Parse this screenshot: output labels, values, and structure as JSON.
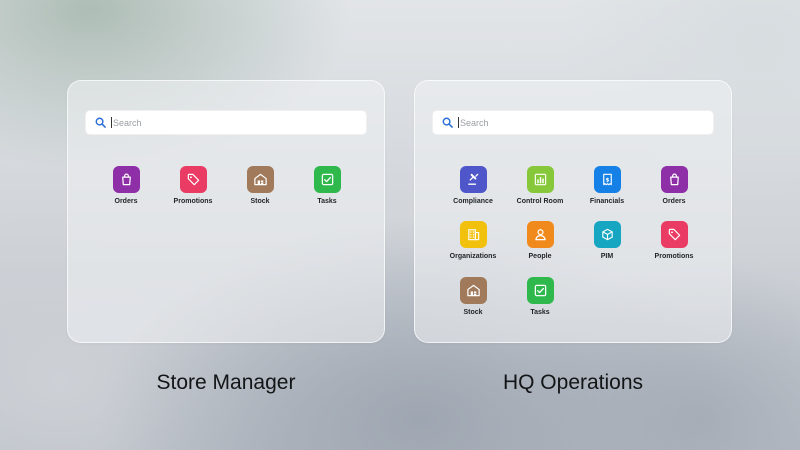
{
  "colors": {
    "orders": "#8e2fa7",
    "promotions": "#ea3b64",
    "stock": "#a07a5a",
    "tasks": "#2fb84c",
    "compliance": "#4f56c9",
    "control_room": "#86c83a",
    "financials": "#1581e6",
    "organizations": "#f2c10e",
    "people": "#f18a1d",
    "pim": "#16a6c1",
    "search_icon": "#2d6fd6"
  },
  "store_manager": {
    "title": "Store Manager",
    "search": {
      "placeholder": "Search",
      "icon": "search-icon"
    },
    "apps": [
      {
        "label": "Orders",
        "icon": "shopping-bag-icon"
      },
      {
        "label": "Promotions",
        "icon": "tag-icon"
      },
      {
        "label": "Stock",
        "icon": "warehouse-icon"
      },
      {
        "label": "Tasks",
        "icon": "checkbox-icon"
      }
    ]
  },
  "hq_operations": {
    "title": "HQ Operations",
    "search": {
      "placeholder": "Search",
      "icon": "search-icon"
    },
    "apps": [
      {
        "label": "Compliance",
        "icon": "gavel-icon"
      },
      {
        "label": "Control Room",
        "icon": "bar-chart-icon"
      },
      {
        "label": "Financials",
        "icon": "receipt-icon"
      },
      {
        "label": "Orders",
        "icon": "shopping-bag-icon"
      },
      {
        "label": "Organizations",
        "icon": "building-icon"
      },
      {
        "label": "People",
        "icon": "person-icon"
      },
      {
        "label": "PIM",
        "icon": "cube-icon"
      },
      {
        "label": "Promotions",
        "icon": "tag-icon"
      },
      {
        "label": "Stock",
        "icon": "warehouse-icon"
      },
      {
        "label": "Tasks",
        "icon": "checkbox-icon"
      }
    ]
  }
}
